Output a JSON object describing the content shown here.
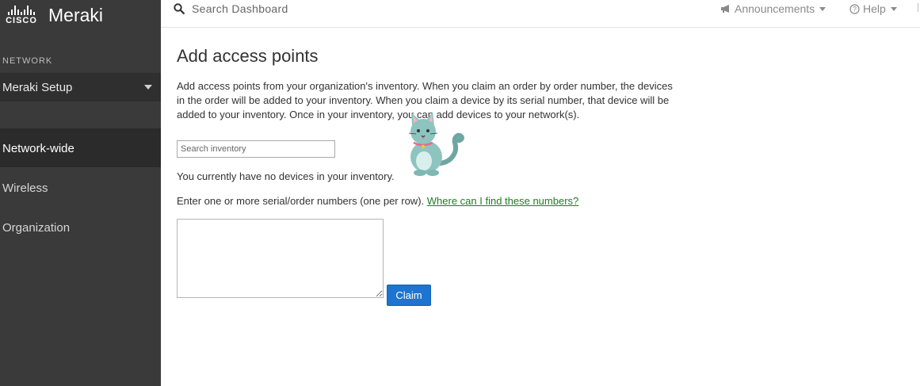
{
  "brand": {
    "cisco_word": "CISCO",
    "product_name": "Meraki"
  },
  "sidebar": {
    "section_label": "NETWORK",
    "network_selector": "Meraki Setup",
    "items": [
      {
        "label": "Network-wide",
        "active": true
      },
      {
        "label": "Wireless",
        "active": false
      },
      {
        "label": "Organization",
        "active": false
      }
    ]
  },
  "topbar": {
    "search_label": "Search Dashboard",
    "announcements_label": "Announcements",
    "help_label": "Help"
  },
  "main": {
    "title": "Add access points",
    "intro": "Add access points from your organization's inventory. When you claim an order by order number, the devices in the order will be added to your inventory. When you claim a device by its serial number, that device will be added to your inventory. Once in your inventory, you can add devices to your network(s).",
    "inventory_search_placeholder": "Search inventory",
    "no_devices_text": "You currently have no devices in your inventory.",
    "enter_numbers_text": "Enter one or more serial/order numbers (one per row).",
    "help_link_text": "Where can I find these numbers?",
    "serial_numbers_value": "",
    "claim_button_label": "Claim"
  },
  "icons": {
    "search": "search-icon",
    "announcements": "megaphone-icon",
    "help": "question-circle-icon",
    "dropdown": "caret-down-icon",
    "cisco_logo": "cisco-logo-icon",
    "decoration": "cat-illustration"
  },
  "colors": {
    "sidebar_bg": "#3a3a3a",
    "active_item_bg": "#2b2b2b",
    "primary_button": "#1d74d1",
    "link": "#1f7d1f"
  }
}
